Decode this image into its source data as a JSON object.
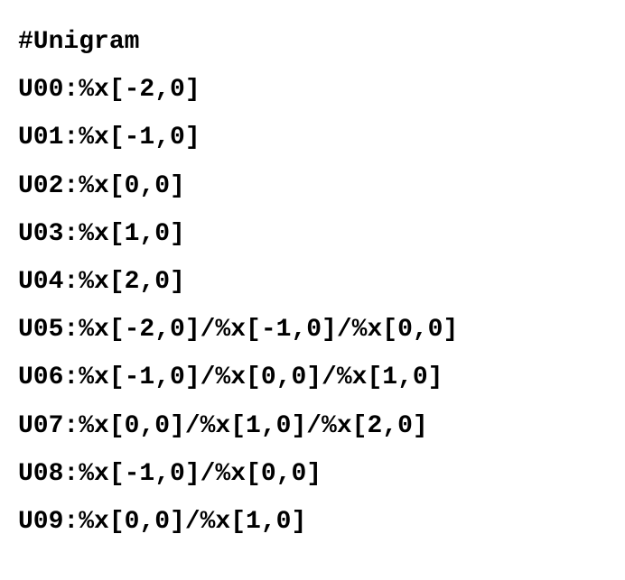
{
  "lines": {
    "header": "#Unigram",
    "u00": "U00:%x[-2,0]",
    "u01": "U01:%x[-1,0]",
    "u02": "U02:%x[0,0]",
    "u03": "U03:%x[1,0]",
    "u04": "U04:%x[2,0]",
    "u05": "U05:%x[-2,0]/%x[-1,0]/%x[0,0]",
    "u06": "U06:%x[-1,0]/%x[0,0]/%x[1,0]",
    "u07": "U07:%x[0,0]/%x[1,0]/%x[2,0]",
    "u08": "U08:%x[-1,0]/%x[0,0]",
    "u09": "U09:%x[0,0]/%x[1,0]"
  }
}
